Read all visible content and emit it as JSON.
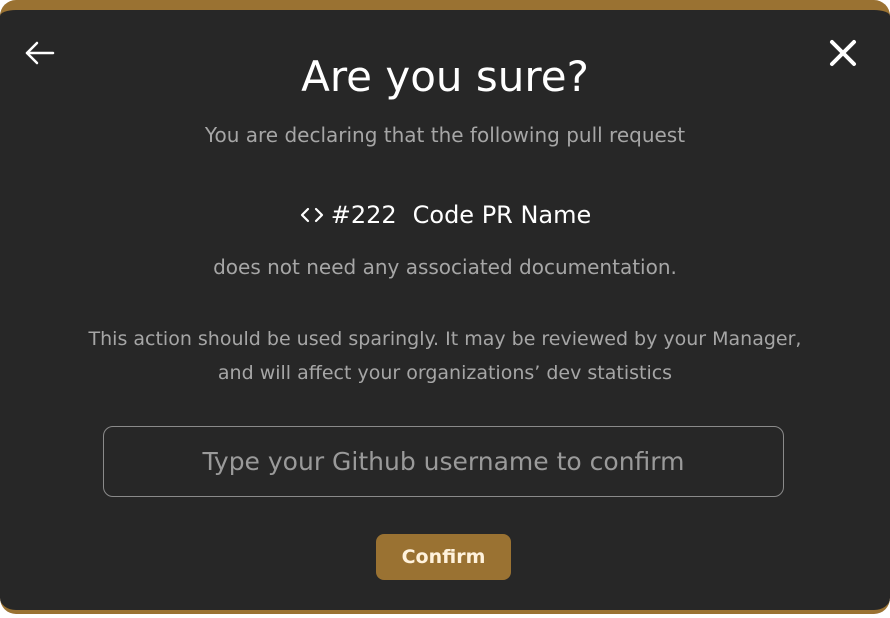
{
  "modal": {
    "title": "Are you sure?",
    "subtitle": "You are declaring that the following pull request",
    "pull_request": {
      "icon": "code-icon",
      "number": "#222",
      "name": "Code PR Name"
    },
    "doc_text": "does not need any associated documentation.",
    "warning_line_1": "This action should be used sparingly. It may be reviewed by your Manager,",
    "warning_line_2": "and will affect your organizations’ dev statistics",
    "input": {
      "placeholder": "Type your Github username to confirm",
      "value": ""
    },
    "confirm_label": "Confirm",
    "back_icon": "arrow-left-icon",
    "close_icon": "close-icon"
  },
  "colors": {
    "background": "#272727",
    "accent": "#9a7232",
    "text_primary": "#ffffff",
    "text_secondary": "#a6a6a6"
  }
}
